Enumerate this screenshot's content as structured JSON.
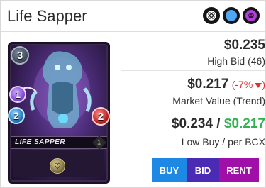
{
  "header": {
    "title": "Life Sapper",
    "icons": [
      "neutral-ring-icon",
      "water-element-icon",
      "death-element-icon"
    ],
    "icon_colors": {
      "neutral": "#ffffff",
      "water": "#4ea8f5",
      "death": "#b040d8"
    }
  },
  "card": {
    "name": "LIFE SAPPER",
    "mana": "3",
    "speed": "1",
    "magic": "2",
    "health": "2",
    "level": "1"
  },
  "high_bid": {
    "price": "$0.235",
    "label": "High Bid (46)"
  },
  "market": {
    "price": "$0.217",
    "change": "(-7%",
    "change_close": ")",
    "label": "Market Value (Trend)"
  },
  "low_buy": {
    "price_low": "$0.234",
    "divider": " / ",
    "price_bcx": "$0.217",
    "label": "Low Buy / per BCX"
  },
  "buttons": {
    "buy": "BUY",
    "bid": "BID",
    "rent": "RENT"
  },
  "colors": {
    "buy": "#1e88e5",
    "bid": "#4b2bb3",
    "rent": "#a00fa8",
    "trend_down": "#e03131",
    "price_green": "#2fb24f"
  }
}
